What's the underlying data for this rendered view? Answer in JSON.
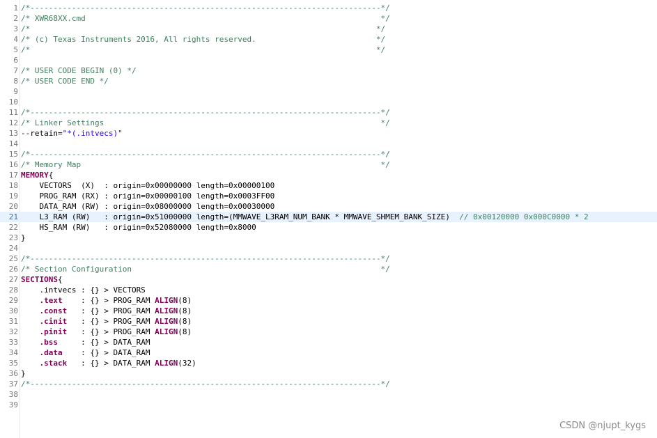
{
  "editor": {
    "current_line": 21,
    "lines": [
      {
        "n": "1",
        "tokens": [
          {
            "t": "c",
            "v": "/*----------------------------------------------------------------------------*/"
          }
        ]
      },
      {
        "n": "2",
        "tokens": [
          {
            "t": "c",
            "v": "/* XWR68XX.cmd                                                                */"
          }
        ]
      },
      {
        "n": "3",
        "tokens": [
          {
            "t": "c",
            "v": "/*                                                                           */"
          }
        ]
      },
      {
        "n": "4",
        "tokens": [
          {
            "t": "c",
            "v": "/* (c) Texas Instruments 2016, All rights reserved.                          */"
          }
        ]
      },
      {
        "n": "5",
        "tokens": [
          {
            "t": "c",
            "v": "/*                                                                           */"
          }
        ]
      },
      {
        "n": "6",
        "tokens": []
      },
      {
        "n": "7",
        "tokens": [
          {
            "t": "c",
            "v": "/* USER CODE BEGIN (0) */"
          }
        ]
      },
      {
        "n": "8",
        "tokens": [
          {
            "t": "c",
            "v": "/* USER CODE END */"
          }
        ]
      },
      {
        "n": "9",
        "tokens": []
      },
      {
        "n": "10",
        "tokens": []
      },
      {
        "n": "11",
        "tokens": [
          {
            "t": "c",
            "v": "/*----------------------------------------------------------------------------*/"
          }
        ]
      },
      {
        "n": "12",
        "tokens": [
          {
            "t": "c",
            "v": "/* Linker Settings                                                            */"
          }
        ]
      },
      {
        "n": "13",
        "tokens": [
          {
            "t": "p",
            "v": "--retain="
          },
          {
            "t": "s",
            "v": "\"*(.intvecs)\""
          }
        ]
      },
      {
        "n": "14",
        "tokens": []
      },
      {
        "n": "15",
        "tokens": [
          {
            "t": "c",
            "v": "/*----------------------------------------------------------------------------*/"
          }
        ]
      },
      {
        "n": "16",
        "tokens": [
          {
            "t": "c",
            "v": "/* Memory Map                                                                 */"
          }
        ]
      },
      {
        "n": "17",
        "tokens": [
          {
            "t": "k",
            "v": "MEMORY"
          },
          {
            "t": "p",
            "v": "{"
          }
        ]
      },
      {
        "n": "18",
        "tokens": [
          {
            "t": "p",
            "v": "    VECTORS  (X)  : origin=0x00000000 length=0x00000100"
          }
        ]
      },
      {
        "n": "19",
        "tokens": [
          {
            "t": "p",
            "v": "    PROG_RAM (RX) : origin=0x00000100 length=0x0003FF00"
          }
        ]
      },
      {
        "n": "20",
        "tokens": [
          {
            "t": "p",
            "v": "    DATA_RAM (RW) : origin=0x08000000 length=0x00030000"
          }
        ]
      },
      {
        "n": "21",
        "tokens": [
          {
            "t": "p",
            "v": "    L3_RAM (RW)   : origin=0x51000000 length=(MMWAVE_L3RAM_NUM_BANK * MMWAVE_SHMEM_BANK_SIZE)  "
          },
          {
            "t": "c",
            "v": "// 0x00120000 0x000C0000 * 2"
          }
        ]
      },
      {
        "n": "22",
        "tokens": [
          {
            "t": "p",
            "v": "    HS_RAM (RW)   : origin=0x52080000 length=0x8000"
          }
        ]
      },
      {
        "n": "23",
        "tokens": [
          {
            "t": "p",
            "v": "}"
          }
        ]
      },
      {
        "n": "24",
        "tokens": []
      },
      {
        "n": "25",
        "tokens": [
          {
            "t": "c",
            "v": "/*----------------------------------------------------------------------------*/"
          }
        ]
      },
      {
        "n": "26",
        "tokens": [
          {
            "t": "c",
            "v": "/* Section Configuration                                                      */"
          }
        ]
      },
      {
        "n": "27",
        "tokens": [
          {
            "t": "k",
            "v": "SECTIONS"
          },
          {
            "t": "p",
            "v": "{"
          }
        ]
      },
      {
        "n": "28",
        "tokens": [
          {
            "t": "p",
            "v": "    .intvecs : {} > VECTORS"
          }
        ]
      },
      {
        "n": "29",
        "tokens": [
          {
            "t": "p",
            "v": "    "
          },
          {
            "t": "k",
            "v": ".text"
          },
          {
            "t": "p",
            "v": "    : {} > PROG_RAM "
          },
          {
            "t": "k",
            "v": "ALIGN"
          },
          {
            "t": "p",
            "v": "(8)"
          }
        ]
      },
      {
        "n": "30",
        "tokens": [
          {
            "t": "p",
            "v": "    "
          },
          {
            "t": "k",
            "v": ".const"
          },
          {
            "t": "p",
            "v": "   : {} > PROG_RAM "
          },
          {
            "t": "k",
            "v": "ALIGN"
          },
          {
            "t": "p",
            "v": "(8)"
          }
        ]
      },
      {
        "n": "31",
        "tokens": [
          {
            "t": "p",
            "v": "    "
          },
          {
            "t": "k",
            "v": ".cinit"
          },
          {
            "t": "p",
            "v": "   : {} > PROG_RAM "
          },
          {
            "t": "k",
            "v": "ALIGN"
          },
          {
            "t": "p",
            "v": "(8)"
          }
        ]
      },
      {
        "n": "32",
        "tokens": [
          {
            "t": "p",
            "v": "    "
          },
          {
            "t": "k",
            "v": ".pinit"
          },
          {
            "t": "p",
            "v": "   : {} > PROG_RAM "
          },
          {
            "t": "k",
            "v": "ALIGN"
          },
          {
            "t": "p",
            "v": "(8)"
          }
        ]
      },
      {
        "n": "33",
        "tokens": [
          {
            "t": "p",
            "v": "    "
          },
          {
            "t": "k",
            "v": ".bss"
          },
          {
            "t": "p",
            "v": "     : {} > DATA_RAM"
          }
        ]
      },
      {
        "n": "34",
        "tokens": [
          {
            "t": "p",
            "v": "    "
          },
          {
            "t": "k",
            "v": ".data"
          },
          {
            "t": "p",
            "v": "    : {} > DATA_RAM"
          }
        ]
      },
      {
        "n": "35",
        "tokens": [
          {
            "t": "p",
            "v": "    "
          },
          {
            "t": "k",
            "v": ".stack"
          },
          {
            "t": "p",
            "v": "   : {} > DATA_RAM "
          },
          {
            "t": "k",
            "v": "ALIGN"
          },
          {
            "t": "p",
            "v": "(32)"
          }
        ]
      },
      {
        "n": "36",
        "tokens": [
          {
            "t": "p",
            "v": "}"
          }
        ]
      },
      {
        "n": "37",
        "tokens": [
          {
            "t": "c",
            "v": "/*----------------------------------------------------------------------------*/"
          }
        ]
      },
      {
        "n": "38",
        "tokens": []
      },
      {
        "n": "39",
        "tokens": []
      }
    ]
  },
  "watermark": "CSDN @njupt_kygs",
  "colors": {
    "comment": "#3f7f5f",
    "string": "#2a00ff",
    "keyword": "#7f0055",
    "current_line_bg": "#e8f2fe"
  }
}
